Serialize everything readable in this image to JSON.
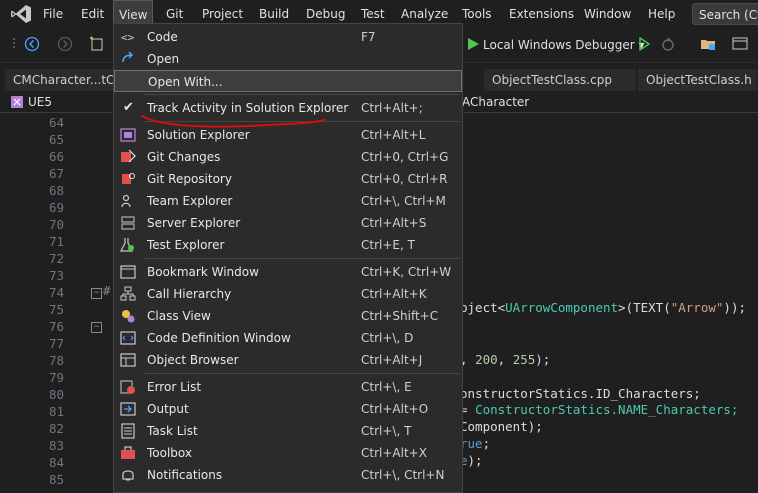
{
  "menubar": {
    "items": [
      "File",
      "Edit",
      "View",
      "Git",
      "Project",
      "Build",
      "Debug",
      "Test",
      "Analyze",
      "Tools",
      "Extensions",
      "Window",
      "Help"
    ],
    "search_label": "Search (Ctr"
  },
  "toolbar": {
    "debugger_target": "Local Windows Debugger"
  },
  "tabs": [
    {
      "label": "CMCharacter...tCo"
    },
    {
      "label": "ObjectTestClass.cpp"
    },
    {
      "label": "ObjectTestClass.h"
    }
  ],
  "navbar": {
    "project": "UE5",
    "member": "ACharacter"
  },
  "editor": {
    "line_numbers": [
      "64",
      "65",
      "66",
      "67",
      "68",
      "69",
      "70",
      "71",
      "72",
      "73",
      "74",
      "75",
      "76",
      "77",
      "78",
      "79",
      "80",
      "81",
      "82",
      "83",
      "84",
      "85"
    ],
    "code": {
      "l74_a": "bject<",
      "l74_type": "UArrowComponent",
      "l74_b": ">(TEXT(",
      "l74_str": "\"Arrow\"",
      "l74_c": "));",
      "l78_a": ", ",
      "l78_n1": "200",
      "l78_b": ", ",
      "l78_n2": "255",
      "l78_c": ");",
      "l80": "onstructorStatics.ID_Characters;",
      "l81_a": "= ",
      "l81_b": "ConstructorStatics.NAME_Characters;",
      "l82": "Component);",
      "l83_kw": "rue",
      "l83_b": ";",
      "l84_kw": "e",
      "l84_b": ");"
    }
  },
  "view_menu": {
    "items": [
      {
        "label": "Code",
        "shortcut": "F7",
        "icon": "code-icon"
      },
      {
        "label": "Open",
        "shortcut": "",
        "icon": "open-icon"
      },
      {
        "label": "Open With...",
        "shortcut": "",
        "icon": ""
      },
      {
        "label": "Track Activity in Solution Explorer",
        "shortcut": "Ctrl+Alt+;",
        "icon": "checkmark-icon"
      },
      {
        "label": "Solution Explorer",
        "shortcut": "Ctrl+Alt+L",
        "icon": "solution-explorer-icon"
      },
      {
        "label": "Git Changes",
        "shortcut": "Ctrl+0, Ctrl+G",
        "icon": "git-changes-icon"
      },
      {
        "label": "Git Repository",
        "shortcut": "Ctrl+0, Ctrl+R",
        "icon": "git-repository-icon"
      },
      {
        "label": "Team Explorer",
        "shortcut": "Ctrl+\\, Ctrl+M",
        "icon": "team-explorer-icon"
      },
      {
        "label": "Server Explorer",
        "shortcut": "Ctrl+Alt+S",
        "icon": "server-explorer-icon"
      },
      {
        "label": "Test Explorer",
        "shortcut": "Ctrl+E, T",
        "icon": "test-explorer-icon"
      },
      {
        "label": "Bookmark Window",
        "shortcut": "Ctrl+K, Ctrl+W",
        "icon": "bookmark-window-icon"
      },
      {
        "label": "Call Hierarchy",
        "shortcut": "Ctrl+Alt+K",
        "icon": "call-hierarchy-icon"
      },
      {
        "label": "Class View",
        "shortcut": "Ctrl+Shift+C",
        "icon": "class-view-icon"
      },
      {
        "label": "Code Definition Window",
        "shortcut": "Ctrl+\\, D",
        "icon": "code-definition-icon"
      },
      {
        "label": "Object Browser",
        "shortcut": "Ctrl+Alt+J",
        "icon": "object-browser-icon"
      },
      {
        "label": "Error List",
        "shortcut": "Ctrl+\\, E",
        "icon": "error-list-icon"
      },
      {
        "label": "Output",
        "shortcut": "Ctrl+Alt+O",
        "icon": "output-icon"
      },
      {
        "label": "Task List",
        "shortcut": "Ctrl+\\, T",
        "icon": "task-list-icon"
      },
      {
        "label": "Toolbox",
        "shortcut": "Ctrl+Alt+X",
        "icon": "toolbox-icon"
      },
      {
        "label": "Notifications",
        "shortcut": "Ctrl+\\, Ctrl+N",
        "icon": "notifications-icon"
      }
    ]
  },
  "colors": {
    "annotation": "#d01010",
    "accent": "#4ea1ff",
    "git": "#e05050"
  }
}
